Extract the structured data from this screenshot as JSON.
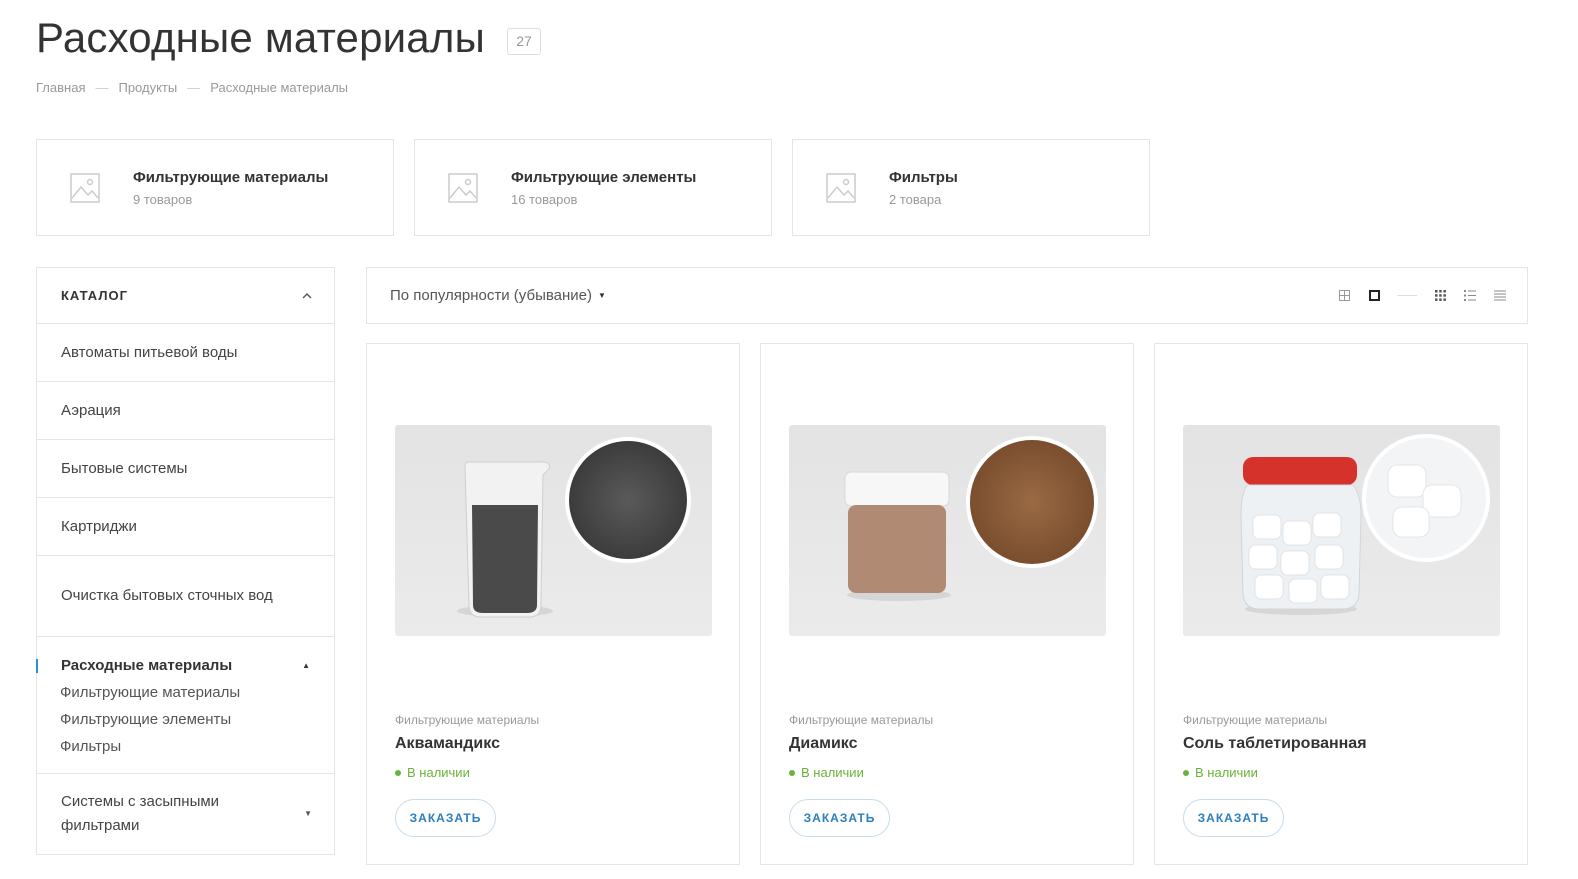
{
  "page": {
    "title": "Расходные материалы",
    "count": "27"
  },
  "breadcrumb": {
    "items": [
      "Главная",
      "Продукты",
      "Расходные материалы"
    ],
    "separator": "—"
  },
  "subcategories": [
    {
      "name": "Фильтрующие материалы",
      "count": "9 товаров"
    },
    {
      "name": "Фильтрующие элементы",
      "count": "16 товаров"
    },
    {
      "name": "Фильтры",
      "count": "2 товара"
    }
  ],
  "sidebar": {
    "title": "КАТАЛОГ",
    "items": [
      "Автоматы питьевой воды",
      "Аэрация",
      "Бытовые системы",
      "Картриджи",
      "Очистка бытовых сточных вод"
    ],
    "active": {
      "label": "Расходные материалы",
      "children": [
        "Фильтрующие материалы",
        "Фильтрующие элементы",
        "Фильтры"
      ]
    },
    "after": "Системы с засыпными фильтрами"
  },
  "sort": {
    "label": "По популярности (убывание)"
  },
  "products": [
    {
      "category": "Фильтрующие материалы",
      "title": "Аквамандикс",
      "stock": "В наличии",
      "button": "ЗАКАЗАТЬ"
    },
    {
      "category": "Фильтрующие материалы",
      "title": "Диамикс",
      "stock": "В наличии",
      "button": "ЗАКАЗАТЬ"
    },
    {
      "category": "Фильтрующие материалы",
      "title": "Соль таблетированная",
      "stock": "В наличии",
      "button": "ЗАКАЗАТЬ"
    }
  ],
  "colors": {
    "accent": "#2a7fc0",
    "in_stock": "#6bb33a",
    "border": "#e5e5e5"
  },
  "icons": [
    "image-placeholder-icon",
    "chevron-up-icon",
    "caret-down-icon",
    "grid-view-icon",
    "tile-view-icon",
    "list-view-icon"
  ]
}
